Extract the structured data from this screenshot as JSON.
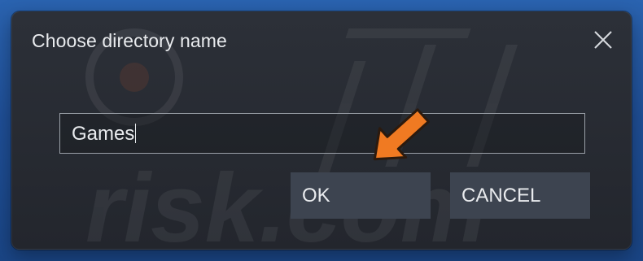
{
  "dialog": {
    "title": "Choose directory name",
    "input_value": "Games",
    "ok_label": "OK",
    "cancel_label": "CANCEL"
  },
  "icons": {
    "close": "close-icon",
    "arrow": "orange-pointer-arrow-icon"
  },
  "watermark": {
    "text": "risk.com"
  },
  "colors": {
    "desktop_background": "#2a63b0",
    "dialog_background": "#2a2e35",
    "button_background": "#3d4450",
    "text": "#e9ebee",
    "arrow_orange": "#f07a22"
  }
}
